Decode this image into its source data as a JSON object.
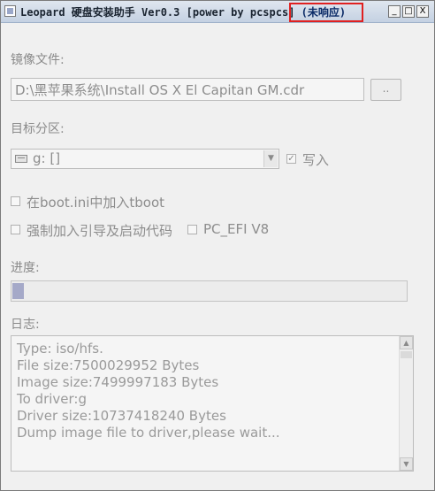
{
  "window": {
    "title": "Leopard 硬盘安装助手 Ver0.3 [power by pcspcs]",
    "not_responding": "(未响应)",
    "minimize_glyph": "_",
    "maximize_glyph": "□",
    "close_glyph": "X"
  },
  "image_file": {
    "label": "镜像文件:",
    "value": "D:\\黑苹果系统\\Install OS X El Capitan GM.cdr",
    "browse_label": ".."
  },
  "target_partition": {
    "label": "目标分区:",
    "selected": "g: []",
    "write_label": "写入",
    "write_checked": "✓"
  },
  "options": {
    "boot_ini_label": "在boot.ini中加入tboot",
    "force_boot_label": "强制加入引导及启动代码",
    "pc_efi_label": "PC_EFI V8"
  },
  "progress": {
    "label": "进度:",
    "value_fraction": 0.03
  },
  "log": {
    "label": "日志:",
    "lines": [
      "Type: iso/hfs.",
      "File size:7500029952 Bytes",
      "Image size:7499997183 Bytes",
      "To driver:g",
      "Driver size:10737418240 Bytes",
      "Dump image file to driver,please wait..."
    ],
    "scroll_up_glyph": "▲",
    "scroll_down_glyph": "▼"
  },
  "colors": {
    "highlight": "#e02020",
    "progress_fill": "#a5a9c8"
  }
}
